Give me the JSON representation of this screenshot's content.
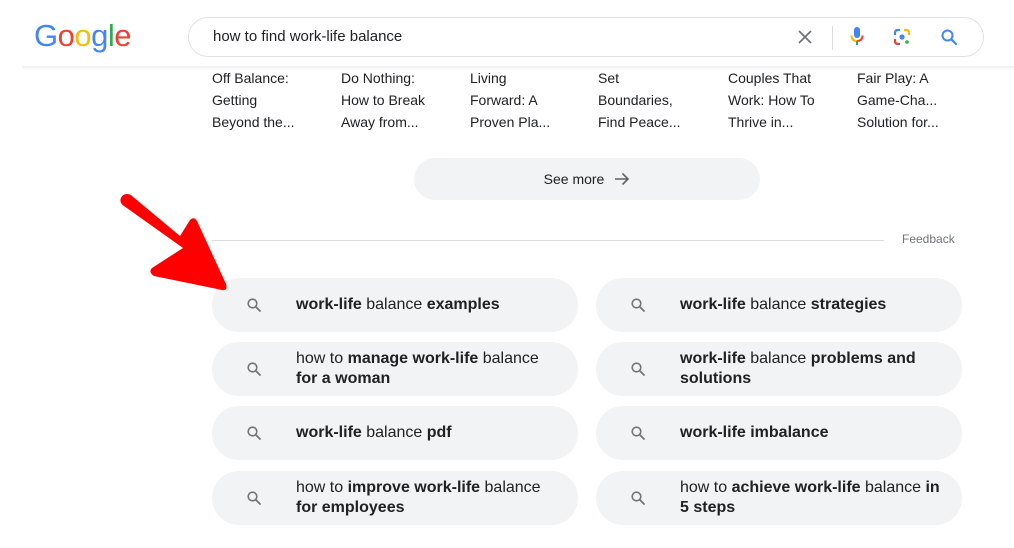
{
  "header": {
    "logo_letters": [
      {
        "char": "G",
        "color": "#4285F4"
      },
      {
        "char": "o",
        "color": "#EA4335"
      },
      {
        "char": "o",
        "color": "#FBBC05"
      },
      {
        "char": "g",
        "color": "#4285F4"
      },
      {
        "char": "l",
        "color": "#34A853"
      },
      {
        "char": "e",
        "color": "#EA4335"
      }
    ],
    "search_query": "how to find work-life balance",
    "icons": {
      "clear": "close-icon",
      "voice": "microphone-icon",
      "lens": "google-lens-icon",
      "search": "search-icon"
    }
  },
  "books": [
    {
      "title_lines": [
        "Off Balance:",
        "Getting",
        "Beyond the..."
      ]
    },
    {
      "title_lines": [
        "Do Nothing:",
        "How to Break",
        "Away from..."
      ]
    },
    {
      "title_lines": [
        "Living",
        "Forward: A",
        "Proven Pla..."
      ]
    },
    {
      "title_lines": [
        "Set",
        "Boundaries,",
        "Find Peace..."
      ]
    },
    {
      "title_lines": [
        "Couples That",
        "Work: How To",
        "Thrive in..."
      ]
    },
    {
      "title_lines": [
        "Fair Play: A",
        "Game-Cha...",
        "Solution for..."
      ]
    }
  ],
  "see_more": {
    "label": "See more",
    "icon": "arrow-right-icon"
  },
  "feedback_label": "Feedback",
  "related_searches": [
    {
      "full_text": "work-life balance examples",
      "segments": [
        {
          "t": "work-life",
          "b": true
        },
        {
          "t": " balance ",
          "b": false
        },
        {
          "t": "examples",
          "b": true
        }
      ]
    },
    {
      "full_text": "work-life balance strategies",
      "segments": [
        {
          "t": "work-life",
          "b": true
        },
        {
          "t": " balance ",
          "b": false
        },
        {
          "t": "strategies",
          "b": true
        }
      ]
    },
    {
      "full_text": "how to manage work-life balance for a woman",
      "segments": [
        {
          "t": "how to ",
          "b": false
        },
        {
          "t": "manage work-life",
          "b": true
        },
        {
          "t": " balance ",
          "b": false
        },
        {
          "t": "for a woman",
          "b": true
        }
      ]
    },
    {
      "full_text": "work-life balance problems and solutions",
      "segments": [
        {
          "t": "work-life",
          "b": true
        },
        {
          "t": " balance ",
          "b": false
        },
        {
          "t": "problems and solutions",
          "b": true
        }
      ]
    },
    {
      "full_text": "work-life balance pdf",
      "segments": [
        {
          "t": "work-life",
          "b": true
        },
        {
          "t": " balance ",
          "b": false
        },
        {
          "t": "pdf",
          "b": true
        }
      ]
    },
    {
      "full_text": "work-life imbalance",
      "segments": [
        {
          "t": "work-life imbalance",
          "b": true
        }
      ]
    },
    {
      "full_text": "how to improve work-life balance for employees",
      "segments": [
        {
          "t": "how to ",
          "b": false
        },
        {
          "t": "improve work-life",
          "b": true
        },
        {
          "t": " balance ",
          "b": false
        },
        {
          "t": "for employees",
          "b": true
        }
      ]
    },
    {
      "full_text": "how to achieve work-life balance in 5 steps",
      "segments": [
        {
          "t": "how to ",
          "b": false
        },
        {
          "t": "achieve work-life",
          "b": true
        },
        {
          "t": " balance ",
          "b": false
        },
        {
          "t": "in 5 steps",
          "b": true
        }
      ]
    }
  ],
  "annotation": {
    "type": "arrow",
    "color": "#FF0000",
    "points_to": "related search: work-life balance examples"
  },
  "colors": {
    "chip_bg": "#F1F3F4",
    "border": "#DFE1E5",
    "muted_text": "#70757A",
    "search_icon_blue": "#4285F4"
  }
}
